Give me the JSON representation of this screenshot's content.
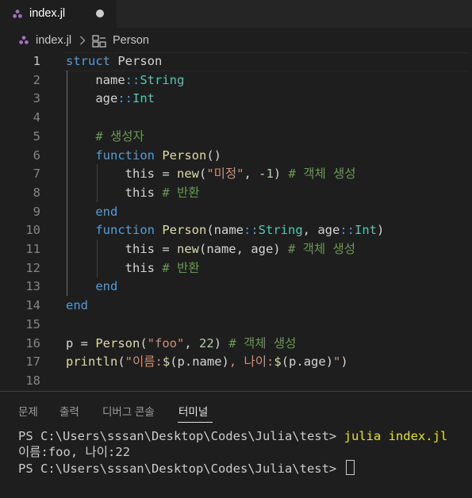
{
  "tab": {
    "file_name": "index.jl",
    "file_icon": "julia-icon",
    "modified": true
  },
  "breadcrumb": {
    "file": "index.jl",
    "separator_icon": "chevron-right-icon",
    "symbol_icon": "struct-icon",
    "symbol": "Person"
  },
  "editor": {
    "line_numbers": [
      "1",
      "2",
      "3",
      "4",
      "5",
      "6",
      "7",
      "8",
      "9",
      "10",
      "11",
      "12",
      "13",
      "14",
      "15",
      "16",
      "17",
      "18"
    ],
    "active_line": "1",
    "lines": [
      [
        [
          "kw",
          "struct"
        ],
        [
          "",
          " Person"
        ]
      ],
      [
        [
          "",
          "    name"
        ],
        [
          "kw",
          "::"
        ],
        [
          "ty",
          "String"
        ]
      ],
      [
        [
          "",
          "    age"
        ],
        [
          "kw",
          "::"
        ],
        [
          "ty",
          "Int"
        ]
      ],
      [
        [
          "",
          ""
        ]
      ],
      [
        [
          "",
          "    "
        ],
        [
          "cm",
          "# 생성자"
        ]
      ],
      [
        [
          "",
          "    "
        ],
        [
          "kw",
          "function"
        ],
        [
          "",
          " "
        ],
        [
          "fn",
          "Person"
        ],
        [
          "",
          "()"
        ]
      ],
      [
        [
          "",
          "        this = "
        ],
        [
          "fn",
          "new"
        ],
        [
          "",
          "("
        ],
        [
          "str",
          "\"미정\""
        ],
        [
          "",
          ", -"
        ],
        [
          "num",
          "1"
        ],
        [
          "",
          ") "
        ],
        [
          "cm",
          "# 객체 생성"
        ]
      ],
      [
        [
          "",
          "        this "
        ],
        [
          "cm",
          "# 반환"
        ]
      ],
      [
        [
          "",
          "    "
        ],
        [
          "kw",
          "end"
        ]
      ],
      [
        [
          "",
          "    "
        ],
        [
          "kw",
          "function"
        ],
        [
          "",
          " "
        ],
        [
          "fn",
          "Person"
        ],
        [
          "",
          "(name"
        ],
        [
          "kw",
          "::"
        ],
        [
          "ty",
          "String"
        ],
        [
          "",
          ", age"
        ],
        [
          "kw",
          "::"
        ],
        [
          "ty",
          "Int"
        ],
        [
          "",
          ")"
        ]
      ],
      [
        [
          "",
          "        this = "
        ],
        [
          "fn",
          "new"
        ],
        [
          "",
          "(name, age) "
        ],
        [
          "cm",
          "# 객체 생성"
        ]
      ],
      [
        [
          "",
          "        this "
        ],
        [
          "cm",
          "# 반환"
        ]
      ],
      [
        [
          "",
          "    "
        ],
        [
          "kw",
          "end"
        ]
      ],
      [
        [
          "kw",
          "end"
        ]
      ],
      [
        [
          "",
          ""
        ]
      ],
      [
        [
          "",
          "p = "
        ],
        [
          "fn",
          "Person"
        ],
        [
          "",
          "("
        ],
        [
          "str",
          "\"foo\""
        ],
        [
          "",
          ", "
        ],
        [
          "num",
          "22"
        ],
        [
          "",
          ") "
        ],
        [
          "cm",
          "# 객체 생성"
        ]
      ],
      [
        [
          "fn",
          "println"
        ],
        [
          "",
          "("
        ],
        [
          "str",
          "\"이름:"
        ],
        [
          "fn",
          "$"
        ],
        [
          "",
          "(p.name)"
        ],
        [
          "str",
          ", 나이:"
        ],
        [
          "fn",
          "$"
        ],
        [
          "",
          "(p.age)"
        ],
        [
          "str",
          "\""
        ],
        [
          "",
          ")"
        ]
      ],
      [
        [
          "",
          ""
        ]
      ]
    ]
  },
  "panel": {
    "tabs": [
      "문제",
      "출력",
      "디버그 콘솔",
      "터미널"
    ],
    "active_tab": "터미널",
    "terminal": {
      "prompt1": "PS C:\\Users\\sssan\\Desktop\\Codes\\Julia\\test> ",
      "command1": "julia index.jl",
      "output": "이름:foo, 나이:22",
      "prompt2": "PS C:\\Users\\sssan\\Desktop\\Codes\\Julia\\test> "
    }
  }
}
